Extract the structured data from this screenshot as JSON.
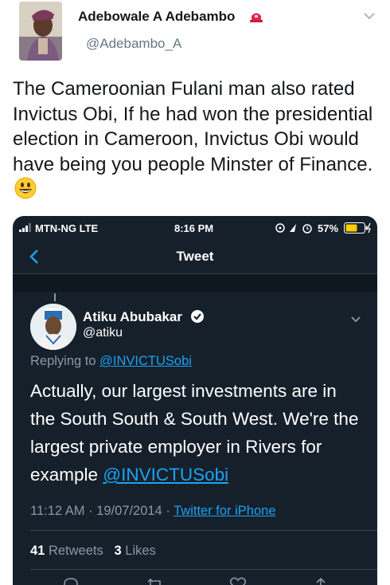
{
  "post": {
    "author_name": "Adebowale A Adebambo",
    "author_handle": "@Adebambo_A",
    "text": "The Cameroonian Fulani man also rated Invictus Obi, If he had won the presidential election in Cameroon, Invictus Obi would have being you people Minster of Finance."
  },
  "screenshot": {
    "status_bar": {
      "carrier": "MTN-NG  LTE",
      "time": "8:16 PM",
      "battery": "57%"
    },
    "nav_title": "Tweet",
    "tweet": {
      "name": "Atiku Abubakar",
      "handle": "@atiku",
      "replying_prefix": "Replying to ",
      "replying_mention": "@INVICTUSobi",
      "text": "Actually, our largest investments are in the South South & South West. We're the largest private employer in Rivers for example ",
      "text_mention": "@INVICTUSobi",
      "timestamp": "11:12 AM · 19/07/2014 · ",
      "source": "Twitter for iPhone",
      "retweets_count": "41",
      "retweets_label": "Retweets",
      "likes_count": "3",
      "likes_label": "Likes"
    }
  },
  "colors": {
    "accent": "#1da1f2",
    "dark_bg": "#15202b",
    "muted": "#8899a6",
    "badge_red": "#e0245e"
  }
}
